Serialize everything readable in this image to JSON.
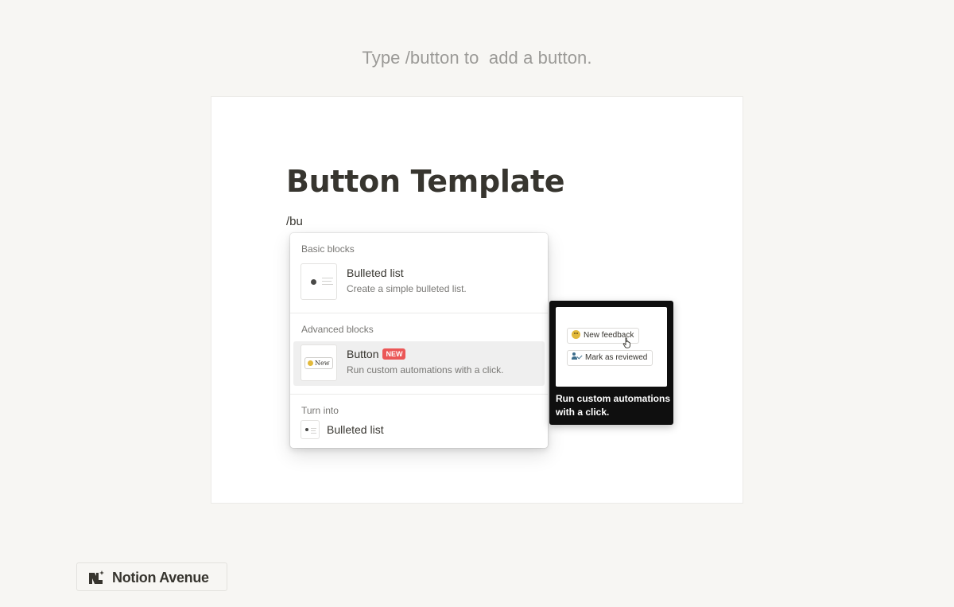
{
  "hint": "Type /button to  add a button.",
  "page": {
    "title": "Button Template",
    "input_text": "/bu"
  },
  "menu": {
    "sections": {
      "basic": "Basic blocks",
      "advanced": "Advanced blocks",
      "turn_into": "Turn into"
    },
    "items": {
      "bulleted_list": {
        "title": "Bulleted list",
        "desc": "Create a simple bulleted list.",
        "icon": "bulleted-list-icon"
      },
      "button": {
        "title": "Button",
        "badge": "NEW",
        "desc": "Run custom automations with a click.",
        "thumb_label": "New",
        "icon": "button-icon"
      },
      "turn_into_bulleted": {
        "title": "Bulleted list",
        "icon": "bulleted-list-icon"
      }
    },
    "selected": "button"
  },
  "preview": {
    "btn1": "New feedback",
    "btn2": "Mark as reviewed",
    "caption": "Run custom automations with a click."
  },
  "brand": {
    "name": "Notion Avenue",
    "logo_icon": "notion-avenue-logo"
  },
  "colors": {
    "background": "#f7f6f3",
    "text": "#37352f",
    "muted": "#787774",
    "badge": "#eb5757",
    "selected_row": "#efefef",
    "preview_bg": "#0f0f0f"
  }
}
